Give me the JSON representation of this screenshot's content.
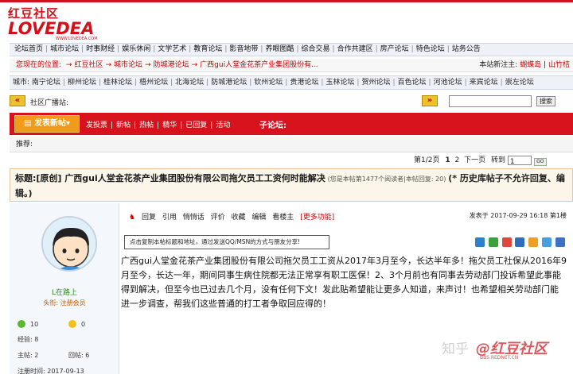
{
  "logo": {
    "line1": "红豆社区",
    "line2": "LOVEDEA",
    "line3": "WWW.LOVEDEA.COM"
  },
  "nav1": [
    "论坛首页",
    "城市论坛",
    "时事财经",
    "娱乐休闲",
    "文学艺术",
    "教育论坛",
    "影音地带",
    "养眼图酷",
    "综合交易",
    "合作共建区",
    "房产论坛",
    "特色论坛",
    "站务公告"
  ],
  "location": {
    "label": "您现在的位置:",
    "crumbs": [
      "红豆社区",
      "城市论坛",
      "防城港论坛",
      "广西gui人堂金花茶产业集团股份有..."
    ],
    "arrow": "→",
    "new_member_label": "本站新注主:",
    "new_members": [
      "蝴蝶岛",
      "山竹桔"
    ]
  },
  "nav2": [
    "城市: 南宁论坛",
    "柳州论坛",
    "桂林论坛",
    "梧州论坛",
    "北海论坛",
    "防城港论坛",
    "钦州论坛",
    "贵港论坛",
    "玉林论坛",
    "贺州论坛",
    "百色论坛",
    "河池论坛",
    "来宾论坛",
    "崇左论坛"
  ],
  "square": {
    "left_arrow": "«",
    "label": "社区广播站:",
    "right_arrow": "»",
    "search_button": "搜索"
  },
  "toolbar": {
    "post_button": "发表新帖",
    "items": [
      "发投票",
      "新帖",
      "热帖",
      "精华",
      "已回复",
      "活动"
    ],
    "subforum_label": "子论坛:"
  },
  "recommend_label": "推荐:",
  "pager": {
    "text": "第1/2页",
    "pages": [
      "1",
      "2"
    ],
    "next": "下一页",
    "goto": "转到",
    "page_value": "1",
    "go": "GO"
  },
  "thread": {
    "title": "标题:[原创] 广西gui人堂金花茶产业集团股份有限公司拖欠员工工资何时能解决",
    "meta": "(您是本帖第1477个阅读者|本帖回复: 20)",
    "note": "(* 历史库帖子不允许回复、编辑。)"
  },
  "user": {
    "name": "L在路上",
    "level": "头衔: 注册会员",
    "green_count": "10",
    "yellow_count": "0",
    "points_label": "经验:",
    "points": "8",
    "topics_label": "主帖:",
    "topics": "2",
    "replies_label": "回帖:",
    "replies": "6",
    "reg_label": "注册时间:",
    "reg_date": "2017-09-13"
  },
  "post": {
    "actions": [
      "回复",
      "引用",
      "悄悄话",
      "评价",
      "收藏",
      "编辑",
      "看楼主"
    ],
    "more": "[更多功能]",
    "time": "发表于 2017-09-29 16:18 第1楼",
    "copy_hint": "点击复制本帖标题和地址，通过发送QQ/MSN的方式与朋友分享!",
    "content": "广西gui人堂金花茶产业集团股份有限公司拖欠员工工资从2017年3月至今，长达半年多！拖欠员工社保从2016年9月至今，长达一年，期间同事生病住院都无法正常享有职工医保！2、3个月前也有同事去劳动部门投诉希望此事能得到解决，但至今也已过去几个月，没有任何下文！发此贴希望能让更多人知道，来声讨！也希望相关劳动部门能进一步调查，帮我们这些普通的打工者争取回应得的！"
  },
  "colors": {
    "brand_red": "#d4111b",
    "toolbar_red": "#d7121d",
    "post_orange": "#f29a1a",
    "nav_bg": "#eef2f8"
  },
  "watermark": {
    "zh": "知乎",
    "brand": "@红豆社区",
    "url": "BBS.REDNET.CN"
  }
}
